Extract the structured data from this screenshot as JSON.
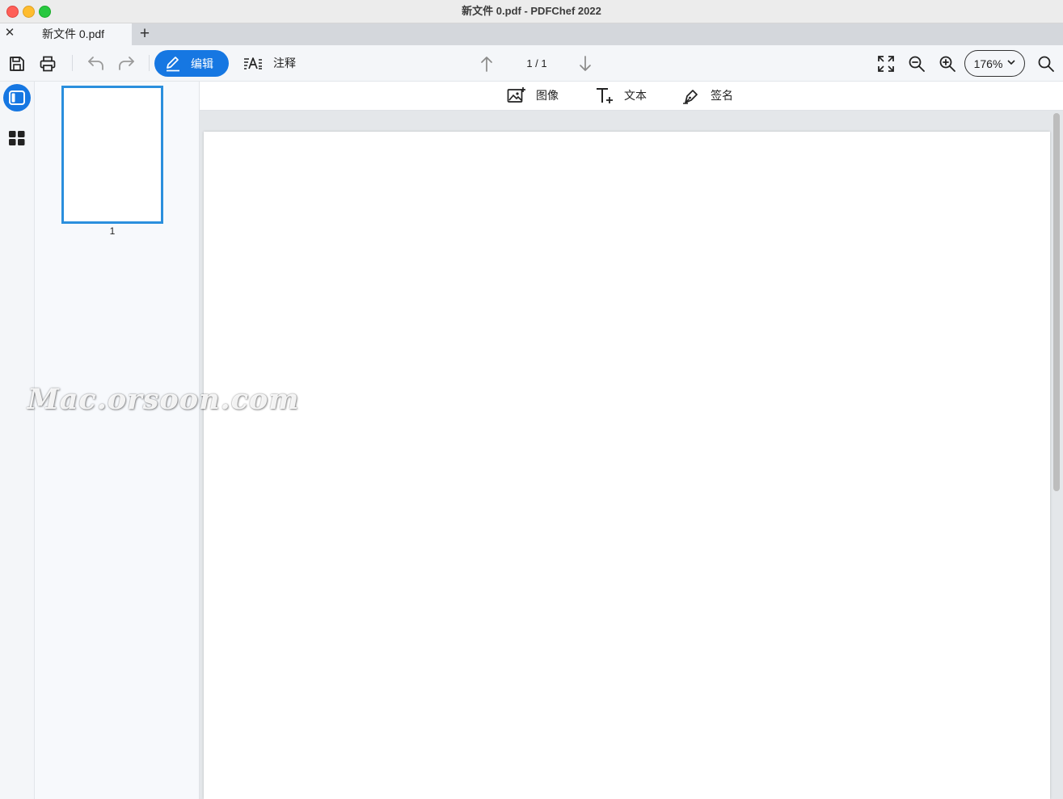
{
  "window": {
    "title": "新文件 0.pdf - PDFChef 2022"
  },
  "tabs": [
    {
      "label": "新文件 0.pdf",
      "close_icon": "close-icon"
    }
  ],
  "tabbar": {
    "add_icon": "plus-icon"
  },
  "toolbar": {
    "edit_label": "编辑",
    "annotate_label": "注释",
    "page_indicator": "1 / 1",
    "zoom_value": "176%"
  },
  "subtoolbar": {
    "image_label": "图像",
    "text_label": "文本",
    "signature_label": "签名"
  },
  "thumbnails": [
    {
      "number": "1",
      "selected": true
    }
  ],
  "watermark": "Mac.orsoon.com",
  "colors": {
    "accent": "#1677e2",
    "thumb_border": "#2b8fdd"
  }
}
